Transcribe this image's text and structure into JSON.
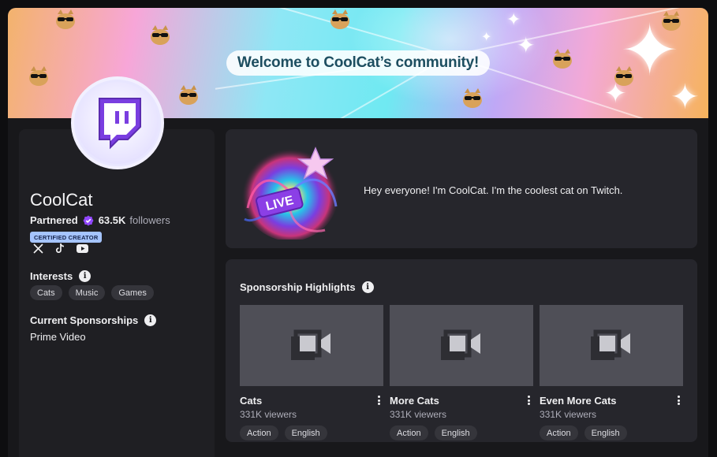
{
  "banner": {
    "welcome_text": "Welcome to CoolCat’s community!"
  },
  "profile": {
    "name": "CoolCat",
    "partner_label": "Partnered",
    "follower_count": "63.5K",
    "followers_label": "followers",
    "badge": "CERTIFIED CREATOR",
    "socials": [
      "x-icon",
      "tiktok-icon",
      "youtube-icon"
    ],
    "interests_title": "Interests",
    "interests": [
      "Cats",
      "Music",
      "Games"
    ],
    "sponsorships_title": "Current Sponsorships",
    "sponsorships": [
      "Prime Video"
    ]
  },
  "about": {
    "text": "Hey everyone! I'm CoolCat. I'm the coolest cat on Twitch.",
    "art_label": "LIVE"
  },
  "sponsorship_highlights": {
    "title": "Sponsorship Highlights",
    "videos": [
      {
        "title": "Cats",
        "views": "331K viewers",
        "tags": [
          "Action",
          "English"
        ]
      },
      {
        "title": "More Cats",
        "views": "331K viewers",
        "tags": [
          "Action",
          "English"
        ]
      },
      {
        "title": "Even More Cats",
        "views": "331K viewers",
        "tags": [
          "Action",
          "English"
        ]
      }
    ]
  },
  "colors": {
    "accent": "#9147ff",
    "badge_bg": "#a5c4ff",
    "card_bg": "#26262c",
    "panel_bg": "#1f1f23"
  }
}
